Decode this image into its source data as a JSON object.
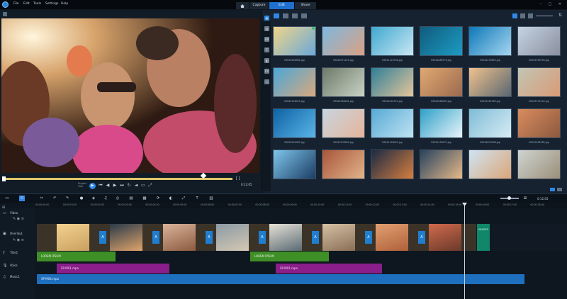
{
  "menu": {
    "file": "File",
    "edit": "Edit",
    "tools": "Tools",
    "settings": "Settings",
    "help": "Help"
  },
  "tabs": {
    "capture": "Capture",
    "edit": "Edit",
    "share": "Share"
  },
  "window_controls": "– □ ✕",
  "player": {
    "project": "Project",
    "clip": "Clip",
    "timecode": "0:12:05"
  },
  "library": {
    "thumbs": [
      {
        "name": "IMG45646962.jpg",
        "colors": [
          "#efd58a",
          "#6aa8d8"
        ],
        "checked": true
      },
      {
        "name": "IMG45071225.jpg",
        "colors": [
          "#7fb8df",
          "#d9a183"
        ],
        "checked": false
      },
      {
        "name": "IMG41125748.jpg",
        "colors": [
          "#3fa8d0",
          "#c9e7f3"
        ],
        "checked": false
      },
      {
        "name": "IMG44889776.jpg",
        "colors": [
          "#0f5c7e",
          "#1e9bc2"
        ],
        "checked": false
      },
      {
        "name": "IMG42276655.jpg",
        "colors": [
          "#0d78b9",
          "#a7d6f0"
        ],
        "checked": false
      },
      {
        "name": "IMG45780799.jpg",
        "colors": [
          "#c5d4e3",
          "#8a8f9e"
        ],
        "checked": false
      },
      {
        "name": "IMG45128015.jpg",
        "colors": [
          "#4aa7d9",
          "#d9a87c"
        ],
        "checked": false
      },
      {
        "name": "IMG44566281.jpg",
        "colors": [
          "#6e7a68",
          "#c8d3c6"
        ],
        "checked": false
      },
      {
        "name": "IMG45445722.jpg",
        "colors": [
          "#2f7f98",
          "#e5c69a"
        ],
        "checked": false
      },
      {
        "name": "IMG40066290.jpg",
        "colors": [
          "#e1a971",
          "#9b6a4f"
        ],
        "checked": false
      },
      {
        "name": "IMG41567063.jpg",
        "colors": [
          "#f0c28e",
          "#5a6670"
        ],
        "checked": false
      },
      {
        "name": "IMG45725140.jpg",
        "colors": [
          "#c3c6b5",
          "#d89a76"
        ],
        "checked": false
      },
      {
        "name": "IMG40240087.jpg",
        "colors": [
          "#0e62a4",
          "#5ab5e6"
        ],
        "checked": false
      },
      {
        "name": "IMG43133642.jpg",
        "colors": [
          "#c8d5e0",
          "#e6b49a"
        ],
        "checked": false
      },
      {
        "name": "IMG41128001.jpg",
        "colors": [
          "#57a9d4",
          "#bfe3f2"
        ],
        "checked": false
      },
      {
        "name": "IMG44159072.jpg",
        "colors": [
          "#2fa0c8",
          "#e8f4fa"
        ],
        "checked": false
      },
      {
        "name": "IMG44875098.jpg",
        "colors": [
          "#7fbcd6",
          "#d7ecf4"
        ],
        "checked": false
      },
      {
        "name": "IMG43285785.jpg",
        "colors": [
          "#d98b5e",
          "#8c5a3f"
        ],
        "checked": false
      },
      {
        "name": "",
        "colors": [
          "#7fc6ec",
          "#1c3d63"
        ],
        "checked": false
      },
      {
        "name": "",
        "colors": [
          "#a8563a",
          "#e2b48a"
        ],
        "checked": false
      },
      {
        "name": "",
        "colors": [
          "#1a2a44",
          "#d77e3e"
        ],
        "checked": false
      },
      {
        "name": "",
        "colors": [
          "#27435e",
          "#e7b989"
        ],
        "checked": false
      },
      {
        "name": "",
        "colors": [
          "#cfe4f2",
          "#dba678"
        ],
        "checked": false
      },
      {
        "name": "",
        "colors": [
          "#cfd4d0",
          "#9b8f7a"
        ],
        "checked": false
      }
    ]
  },
  "ruler": [
    "00:00:00:00",
    "00:00:01:00",
    "00:00:02:00",
    "00:00:03:00",
    "00:00:04:00",
    "00:00:05:00",
    "00:00:06:00",
    "00:00:07:00",
    "00:00:08:00",
    "00:00:09:00",
    "00:00:10:00",
    "00:00:11:00",
    "00:00:12:00",
    "00:00:13:00",
    "00:00:14:00",
    "00:00:15:00",
    "00:00:16:00",
    "00:00:17:00",
    "00:00:18:00"
  ],
  "tracks": {
    "video": "Video",
    "overlay": "Overlay1",
    "title": "Title1",
    "voice": "Voice",
    "music": "Music1"
  },
  "clips": {
    "title_a": "LOREM IPSUM",
    "title_b": "LOREM IPSUM",
    "voice_a": "SP-M01.mpa",
    "voice_b": "SP-M01.mpa",
    "music": "SP-M04.mpa",
    "images": "IMAGES"
  }
}
